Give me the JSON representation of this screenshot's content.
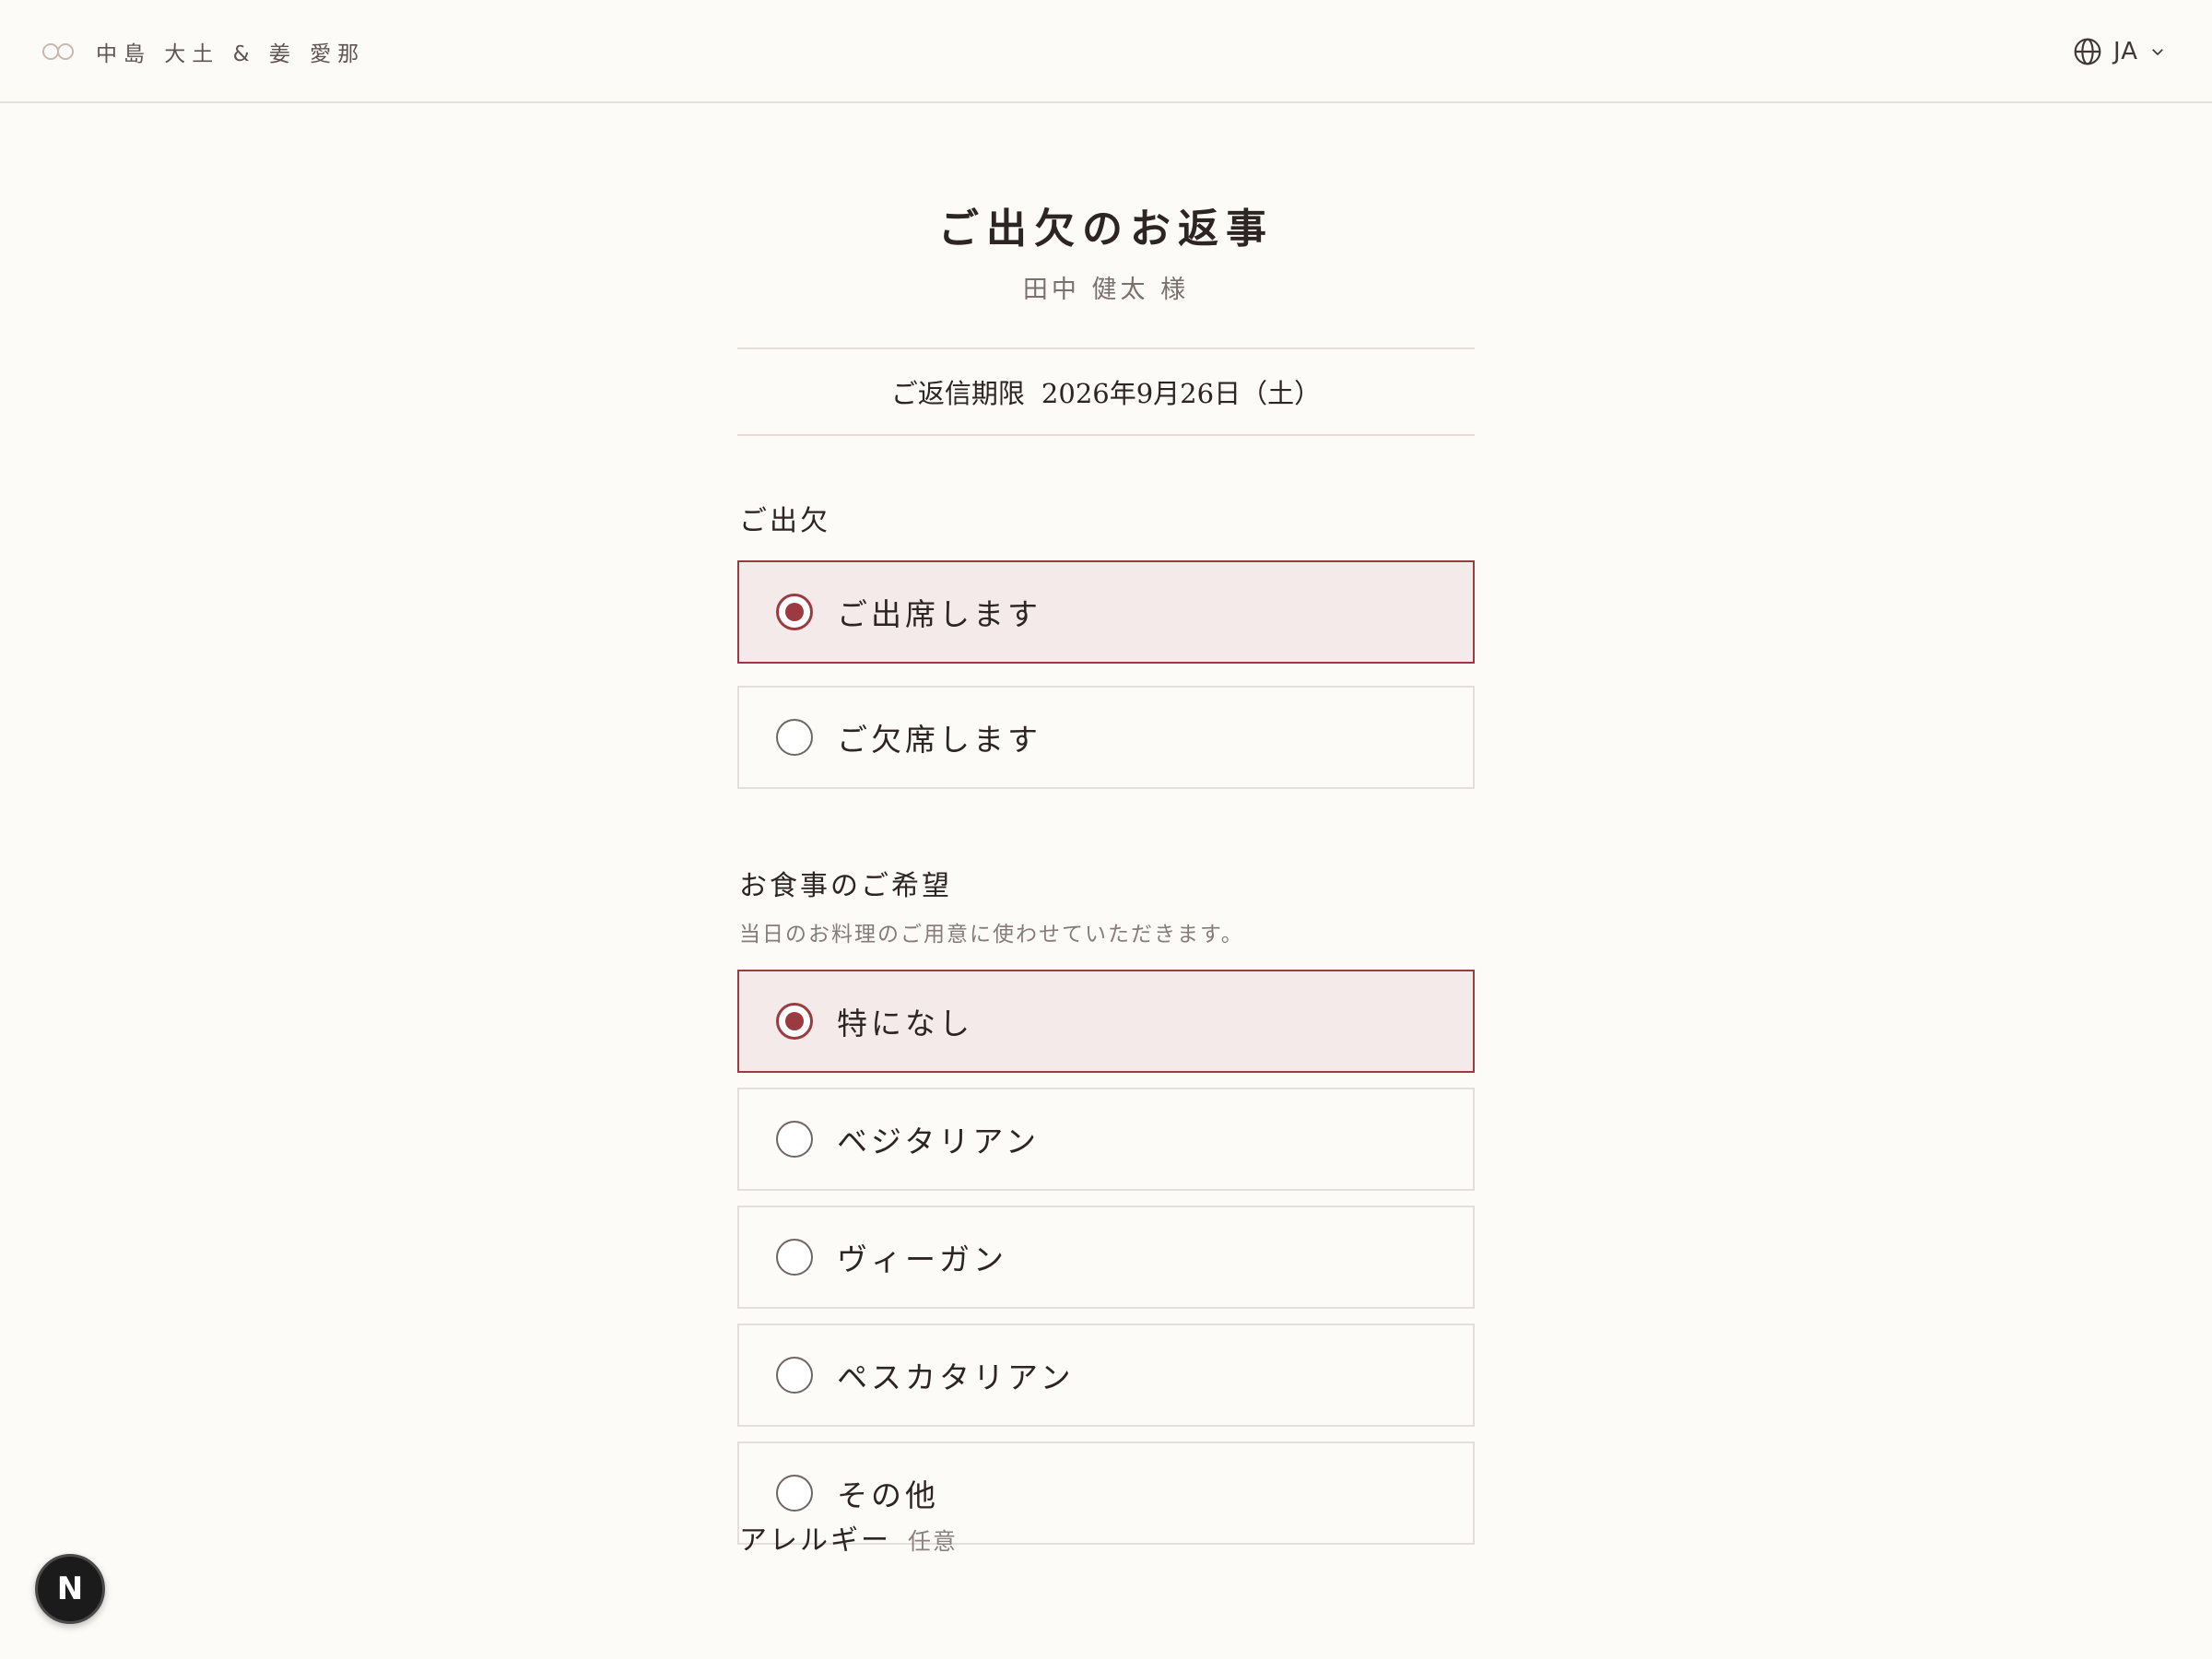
{
  "header": {
    "brand": "中島 大土 & 姜 愛那",
    "language": "JA"
  },
  "page": {
    "title": "ご出欠のお返事",
    "guest_name": "田中 健太 様",
    "deadline_label": "ご返信期限",
    "deadline_date": "2026年9月26日（土）"
  },
  "attendance": {
    "label": "ご出欠",
    "options": [
      {
        "label": "ご出席します",
        "selected": true
      },
      {
        "label": "ご欠席します",
        "selected": false
      }
    ]
  },
  "meal": {
    "label": "お食事のご希望",
    "description": "当日のお料理のご用意に使わせていただきます。",
    "options": [
      {
        "label": "特になし",
        "selected": true
      },
      {
        "label": "ベジタリアン",
        "selected": false
      },
      {
        "label": "ヴィーガン",
        "selected": false
      },
      {
        "label": "ペスカタリアン",
        "selected": false
      },
      {
        "label": "その他",
        "selected": false
      }
    ]
  },
  "allergy": {
    "label": "アレルギー",
    "optional": "任意"
  },
  "badge": {
    "letter": "N"
  },
  "colors": {
    "accent": "#9b3b41",
    "selected_bg": "#f5eaea",
    "page_bg": "#fcfbf8"
  }
}
